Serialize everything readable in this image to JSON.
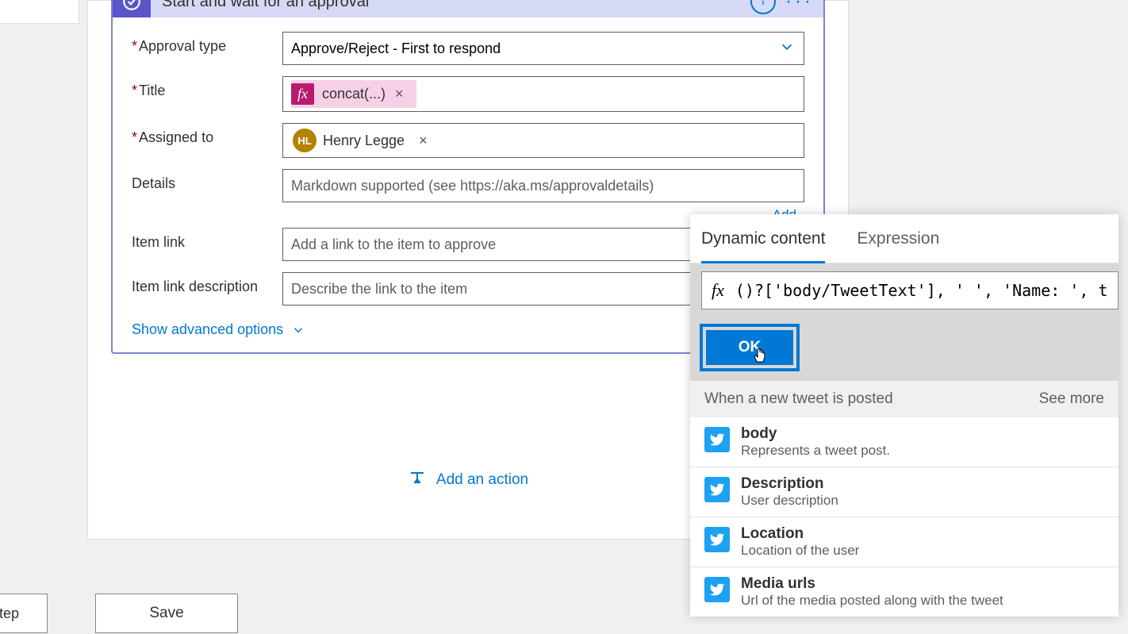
{
  "card": {
    "title": "Start and wait for an approval",
    "menu_dots": "···"
  },
  "form": {
    "approval_type": {
      "label": "Approval type",
      "value": "Approve/Reject - First to respond"
    },
    "title": {
      "label": "Title",
      "token_label": "concat(...)"
    },
    "assigned_to": {
      "label": "Assigned to",
      "initials": "HL",
      "name": "Henry Legge"
    },
    "details": {
      "label": "Details",
      "placeholder": "Markdown supported (see https://aka.ms/approvaldetails)",
      "add_link": "Add"
    },
    "item_link": {
      "label": "Item link",
      "placeholder": "Add a link to the item to approve"
    },
    "item_link_desc": {
      "label": "Item link description",
      "placeholder": "Describe the link to the item"
    },
    "advanced": "Show advanced options"
  },
  "add_action": "Add an action",
  "buttons": {
    "step": "v step",
    "save": "Save"
  },
  "popup": {
    "tab_dynamic": "Dynamic content",
    "tab_expression": "Expression",
    "fx": "fx",
    "expression": "()?['body/TweetText'], ' ', 'Name: ', t",
    "ok": "OK",
    "section_title": "When a new tweet is posted",
    "see_more": "See more",
    "items": [
      {
        "title": "body",
        "desc": "Represents a tweet post."
      },
      {
        "title": "Description",
        "desc": "User description"
      },
      {
        "title": "Location",
        "desc": "Location of the user"
      },
      {
        "title": "Media urls",
        "desc": "Url of the media posted along with the tweet"
      }
    ]
  }
}
